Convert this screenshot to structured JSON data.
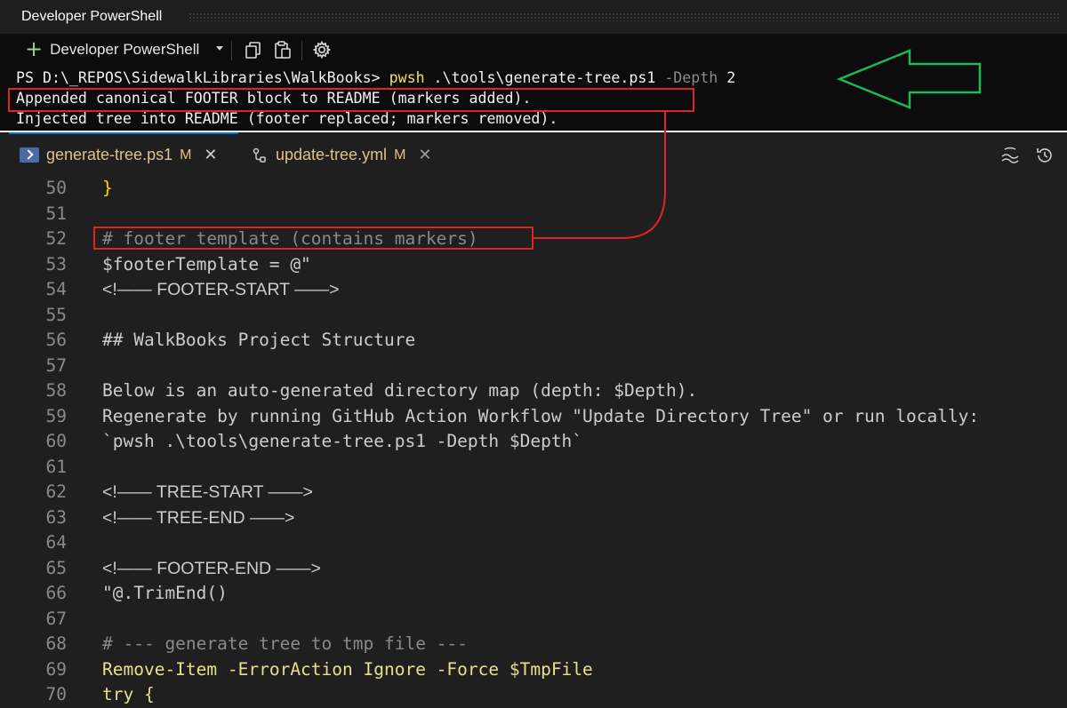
{
  "terminal": {
    "title": "Developer PowerShell",
    "toolbar": {
      "new_terminal_label": "Developer PowerShell"
    },
    "prompt": "PS D:\\_REPOS\\SidewalkLibraries\\WalkBooks> ",
    "command": "pwsh",
    "command_arg": " .\\tools\\generate-tree.ps1 ",
    "command_param": "-Depth",
    "command_value": " 2",
    "output": [
      "Appended canonical FOOTER block to README (markers added).",
      "Injected tree into README (footer replaced; markers removed)."
    ]
  },
  "editor": {
    "tabs": [
      {
        "label": "generate-tree.ps1",
        "status": "M",
        "close": "✕"
      },
      {
        "label": "update-tree.yml",
        "status": "M",
        "close": "✕"
      }
    ],
    "lines": [
      {
        "n": "50",
        "text": "}"
      },
      {
        "n": "51",
        "text": ""
      },
      {
        "n": "52",
        "text": "# footer template (contains markers)"
      },
      {
        "n": "53",
        "text": "$footerTemplate = @\""
      },
      {
        "n": "54",
        "text": "<!—— FOOTER-START ——>"
      },
      {
        "n": "55",
        "text": ""
      },
      {
        "n": "56",
        "text": "## WalkBooks Project Structure"
      },
      {
        "n": "57",
        "text": ""
      },
      {
        "n": "58",
        "text": "Below is an auto-generated directory map (depth: $Depth)."
      },
      {
        "n": "59",
        "text": "Regenerate by running GitHub Action Workflow \"Update Directory Tree\" or run locally:"
      },
      {
        "n": "60",
        "text": "`pwsh .\\tools\\generate-tree.ps1 -Depth $Depth`"
      },
      {
        "n": "61",
        "text": ""
      },
      {
        "n": "62",
        "text": "<!—— TREE-START ——>"
      },
      {
        "n": "63",
        "text": "<!—— TREE-END ——>"
      },
      {
        "n": "64",
        "text": ""
      },
      {
        "n": "65",
        "text": "<!—— FOOTER-END ——>"
      },
      {
        "n": "66",
        "text": "\"@.TrimEnd()"
      },
      {
        "n": "67",
        "text": ""
      },
      {
        "n": "68",
        "text": "# --- generate tree to tmp file ---"
      },
      {
        "n": "69",
        "text": "Remove-Item -ErrorAction Ignore -Force $TmpFile"
      },
      {
        "n": "70",
        "text": "try {"
      }
    ]
  },
  "colors": {
    "annotation_red": "#e02424",
    "annotation_green": "#1db954",
    "tab_accent": "#0078d4",
    "modified": "#e2c08d"
  },
  "icons": [
    "plus-icon",
    "chevron-down-icon",
    "copy-icon",
    "paste-icon",
    "gear-icon",
    "powershell-file-icon",
    "workflow-icon",
    "close-icon",
    "wrench-icon",
    "history-icon",
    "arrow-left-icon"
  ]
}
